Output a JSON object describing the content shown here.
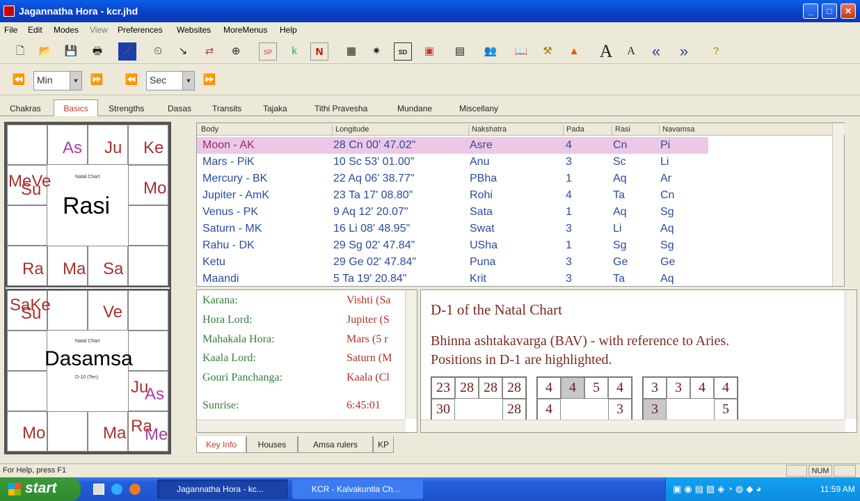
{
  "window": {
    "title": "Jagannatha Hora - kcr.jhd",
    "min": "_",
    "max": "□",
    "close": "✕"
  },
  "menu": [
    "File",
    "Edit",
    "Modes",
    "View",
    "Preferences",
    "Websites",
    "MoreMenus",
    "Help"
  ],
  "toolbar2": {
    "unit1": "Min",
    "unit2": "Sec"
  },
  "tabs": [
    "Chakras",
    "Basics",
    "Strengths",
    "Dasas",
    "Transits",
    "Tajaka",
    "Tithi Pravesha",
    "Mundane",
    "Miscellany"
  ],
  "rasi_chart": {
    "name": "Rasi",
    "subtitle": "Natal Chart",
    "cells": {
      "c1": "As",
      "c2": "Ju",
      "c3": "Ke",
      "w1": "MeVe",
      "w1b": "Su",
      "e1": "Mo",
      "s0": "Ra",
      "s1": "Ma",
      "s2": "Sa"
    }
  },
  "dasamsa_chart": {
    "name": "Dasamsa",
    "subtitle": "Natal Chart",
    "subtitle2": "D-10 (Ten)",
    "cells": {
      "n0": "SaKe",
      "n0b": "Su",
      "n2": "Ve",
      "e1": "Ju",
      "e1b": "As",
      "s0": "Mo",
      "s2": "Ma",
      "s3": "Ra",
      "s3b": "Me"
    }
  },
  "table": {
    "headers": [
      "Body",
      "Longitude",
      "Nakshatra",
      "Pada",
      "Rasi",
      "Navamsa"
    ],
    "rows": [
      [
        "Moon - AK",
        "28 Cn 00' 47.02\"",
        "Asre",
        "4",
        "Cn",
        "Pi"
      ],
      [
        "Mars - PiK",
        "10 Sc 53' 01.00\"",
        "Anu",
        "3",
        "Sc",
        "Li"
      ],
      [
        "Mercury - BK",
        "22 Aq 06' 38.77\"",
        "PBha",
        "1",
        "Aq",
        "Ar"
      ],
      [
        "Jupiter - AmK",
        "23 Ta 17' 08.80\"",
        "Rohi",
        "4",
        "Ta",
        "Cn"
      ],
      [
        "Venus - PK",
        "9 Aq 12' 20.07\"",
        "Sata",
        "1",
        "Aq",
        "Sg"
      ],
      [
        "Saturn - MK",
        "16 Li 08' 48.95\"",
        "Swat",
        "3",
        "Li",
        "Aq"
      ],
      [
        "Rahu - DK",
        "29 Sg 02' 47.84\"",
        "USha",
        "1",
        "Sg",
        "Sg"
      ],
      [
        "Ketu",
        "29 Ge 02' 47.84\"",
        "Puna",
        "3",
        "Ge",
        "Ge"
      ],
      [
        "Maandi",
        "5 Ta 19' 20.84\"",
        "Krit",
        "3",
        "Ta",
        "Aq"
      ]
    ]
  },
  "keyinfo": [
    {
      "label": "Karana:",
      "value": "Vishti (Sa"
    },
    {
      "label": "Hora Lord:",
      "value": "Jupiter (S"
    },
    {
      "label": "Mahakala Hora:",
      "value": "Mars (5 r"
    },
    {
      "label": "Kaala Lord:",
      "value": "Saturn (M"
    },
    {
      "label": "Gouri Panchanga:",
      "value": "Kaala (Cl"
    },
    {
      "label": "Sunrise:",
      "value": "6:45:01"
    }
  ],
  "bav": {
    "title": "D-1 of the Natal Chart",
    "line1": "Bhinna ashtakavarga (BAV) - with reference to Aries.",
    "line2": "Positions in D-1 are highlighted.",
    "grid1": {
      "top": [
        "23",
        "28",
        "28",
        "28"
      ],
      "left": "30",
      "right": "28"
    },
    "grid2": {
      "top": [
        "4",
        "4",
        "5",
        "4"
      ],
      "left": "4",
      "right": "3"
    },
    "grid3": {
      "top": [
        "3",
        "3",
        "4",
        "4"
      ],
      "left": "3",
      "right": "5"
    }
  },
  "bottom_tabs": [
    "Key Info",
    "Houses",
    "Amsa rulers",
    "KP"
  ],
  "status": {
    "help": "For Help, press F1",
    "num": "NUM"
  },
  "taskbar": {
    "start": "start",
    "task1": "Jagannatha Hora - kc...",
    "task2": "KCR - Kalvakuntla Ch...",
    "clock": "11:59 AM"
  }
}
